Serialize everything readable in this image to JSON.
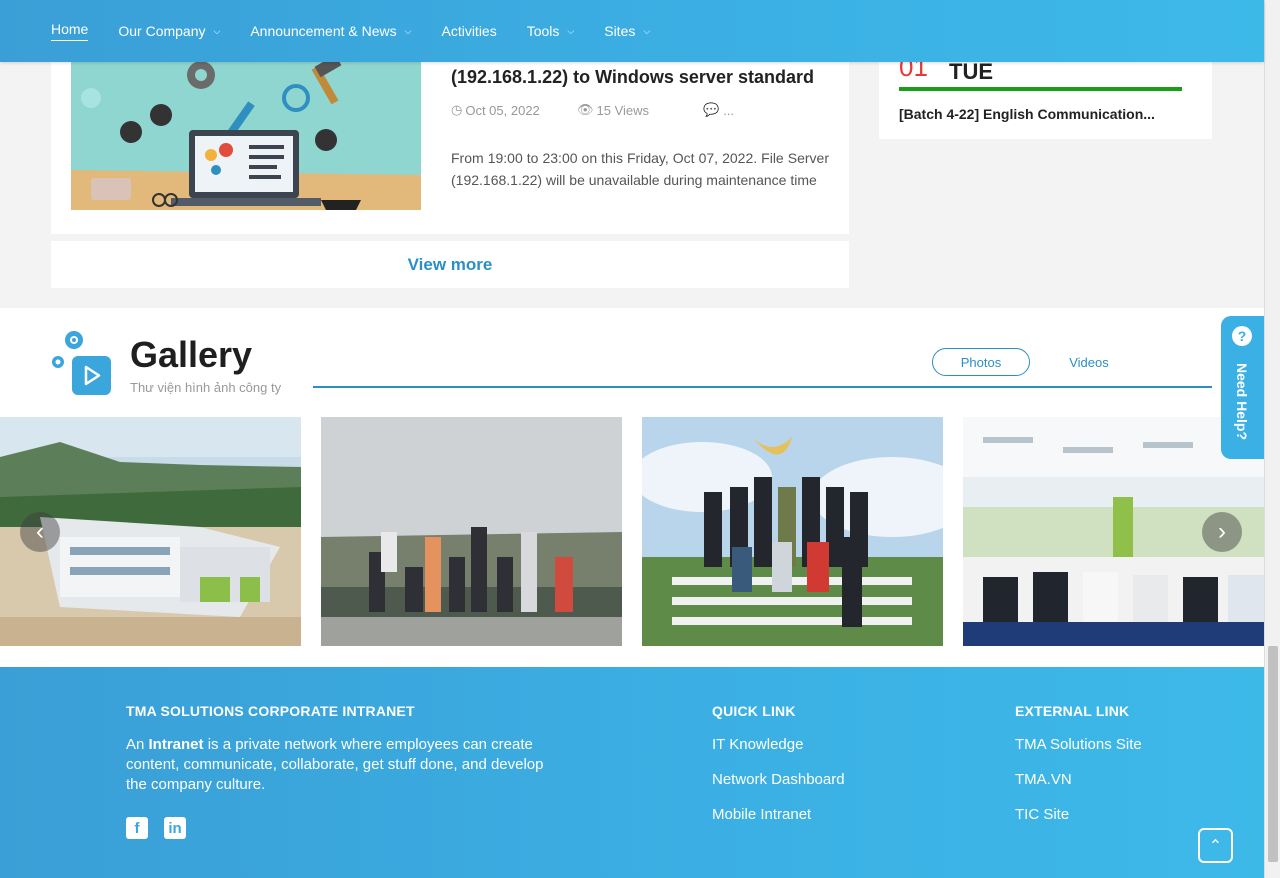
{
  "nav": {
    "items": [
      {
        "label": "Home",
        "caret": false
      },
      {
        "label": "Our Company",
        "caret": true
      },
      {
        "label": "Announcement & News",
        "caret": true
      },
      {
        "label": "Activities",
        "caret": false
      },
      {
        "label": "Tools",
        "caret": true
      },
      {
        "label": "Sites",
        "caret": true
      }
    ]
  },
  "news": {
    "title": "(192.168.1.22) to Windows server standard",
    "date": "Oct 05, 2022",
    "views": "15 Views",
    "comments": "...",
    "description": "From 19:00 to 23:00 on this Friday, Oct 07, 2022. File Server (192.168.1.22) will be unavailable during maintenance time"
  },
  "view_more": "View more",
  "event": {
    "date": "01",
    "day": "TUE",
    "title": "[Batch 4-22] English Communication...",
    "bar_color": "#1a9e1a"
  },
  "gallery": {
    "title": "Gallery",
    "subtitle": "Thư viện hình ảnh công ty",
    "tabs": {
      "photos": "Photos",
      "videos": "Videos"
    }
  },
  "need_help": "Need Help?",
  "footer": {
    "about_heading": "TMA SOLUTIONS CORPORATE INTRANET",
    "about_prefix": "An ",
    "about_bold": "Intranet",
    "about_suffix": " is a private network where employees can create content, communicate, collaborate, get stuff done, and develop the company culture.",
    "quick_heading": "QUICK LINK",
    "quick_links": [
      "IT Knowledge",
      "Network Dashboard",
      "Mobile Intranet"
    ],
    "external_heading": "EXTERNAL LINK",
    "external_links": [
      "TMA Solutions Site",
      "TMA.VN",
      "TIC Site"
    ]
  },
  "colors": {
    "brand_blue": "#3bb0e4",
    "link_blue": "#2b8fc5",
    "event_red": "#e53935"
  }
}
